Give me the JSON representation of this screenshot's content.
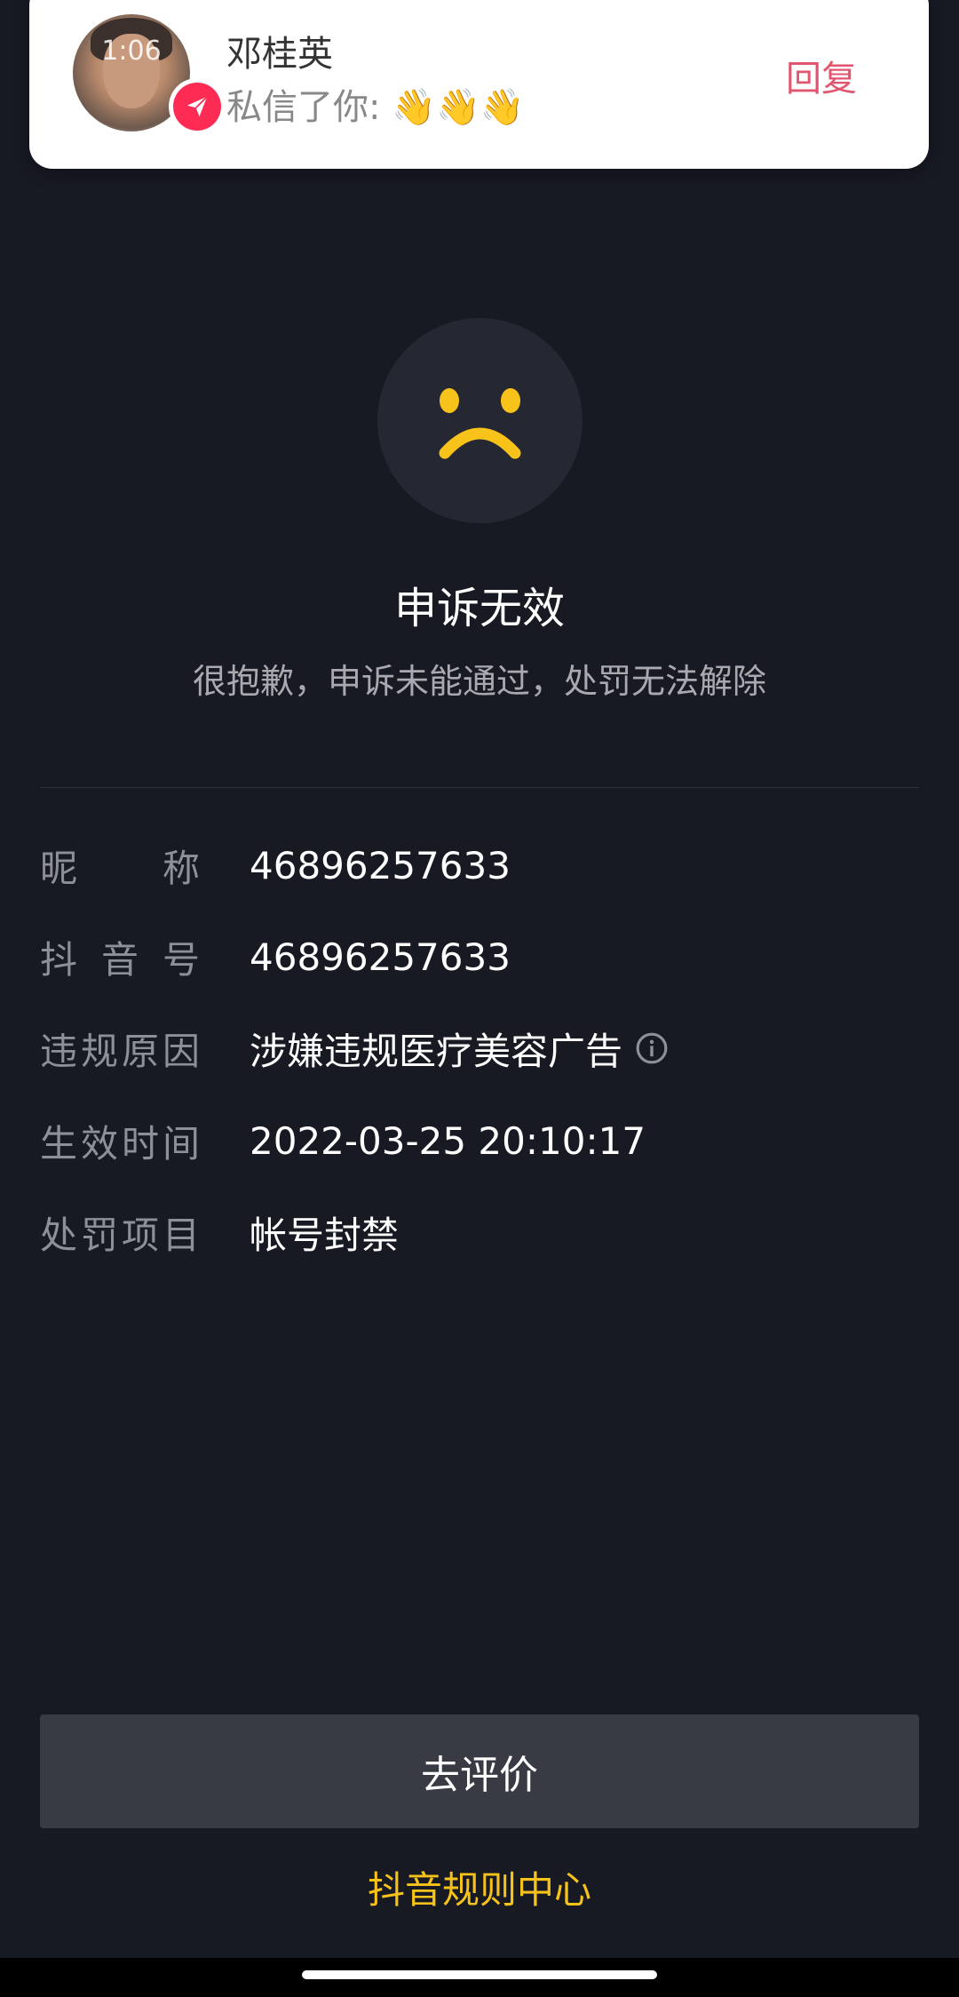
{
  "notification": {
    "avatar_time": "1:06",
    "sender": "邓桂英",
    "message": "私信了你: 👋👋👋",
    "reply_label": "回复"
  },
  "result": {
    "icon": "sad-face-icon",
    "title": "申诉无效",
    "subtitle": "很抱歉，申诉未能通过，处罚无法解除"
  },
  "details": [
    {
      "label": "昵称",
      "value": "46896257633"
    },
    {
      "label": "抖音号",
      "value": "46896257633"
    },
    {
      "label": "违规原因",
      "value": "涉嫌违规医疗美容广告",
      "info_icon": "info-icon"
    },
    {
      "label": "生效时间",
      "value": "2022-03-25 20:10:17"
    },
    {
      "label": "处罚项目",
      "value": "帐号封禁"
    }
  ],
  "actions": {
    "evaluate_label": "去评价",
    "rules_link": "抖音规则中心"
  },
  "colors": {
    "background": "#171923",
    "accent_yellow": "#f7c21a",
    "reply_pink": "#e0566f",
    "badge_red": "#fe2c55"
  }
}
